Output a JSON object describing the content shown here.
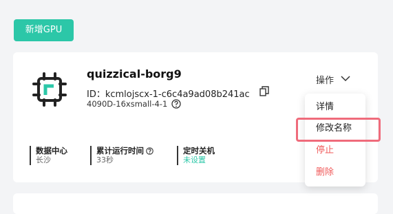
{
  "toolbar": {
    "add_gpu_label": "新增GPU"
  },
  "instance": {
    "name": "quizzical-borg9",
    "id_text": "ID：kcmlojscx-1-c6c4a9ad08b241ac",
    "spec": "4090D-16xsmall-4-1",
    "ops_label": "操作",
    "stats": [
      {
        "label": "数据中心",
        "value": "长沙"
      },
      {
        "label": "累计运行时间",
        "value": "33秒"
      },
      {
        "label": "定时关机",
        "value": "未设置"
      }
    ]
  },
  "menu": {
    "items": [
      {
        "label": "详情"
      },
      {
        "label": "修改名称"
      },
      {
        "label": "停止"
      },
      {
        "label": "删除"
      }
    ]
  },
  "colors": {
    "accent": "#2cc7a8",
    "danger": "#f05a5a",
    "highlight": "#ef6b7b"
  }
}
